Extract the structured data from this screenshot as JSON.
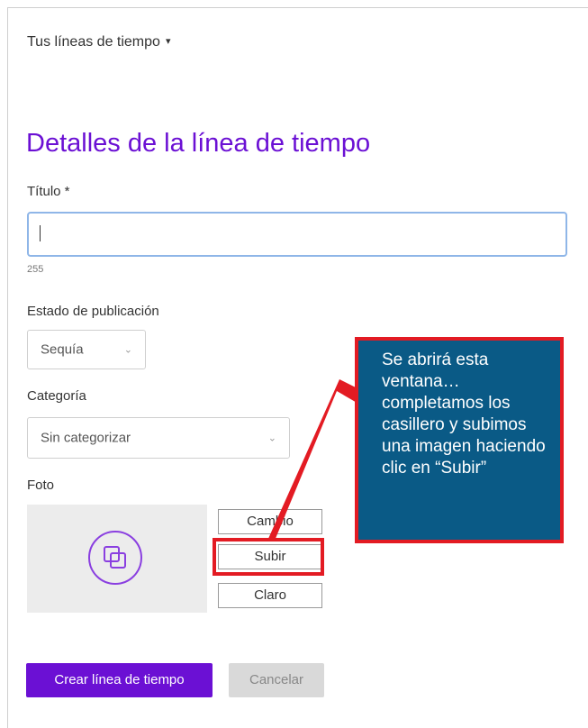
{
  "header": {
    "timelines_menu_label": "Tus líneas de tiempo",
    "caret": "▾"
  },
  "page": {
    "title": "Detalles de la línea de tiempo"
  },
  "form": {
    "title_label": "Título *",
    "title_value": "",
    "char_counter": "255",
    "status_label": "Estado de publicación",
    "status_value": "Sequía",
    "category_label": "Categoría",
    "category_value": "Sin categorizar",
    "photo_label": "Foto"
  },
  "photo_buttons": {
    "change": "Cambio",
    "upload": "Subir",
    "clear": "Claro"
  },
  "actions": {
    "create": "Crear línea de tiempo",
    "cancel": "Cancelar"
  },
  "callout": {
    "text": "Se abrirá esta ventana… completamos los casillero y subimos una imagen haciendo clic en “Subir”"
  },
  "icons": {
    "photo": "stacked-squares-icon",
    "dropdown": "chevron-down-icon"
  },
  "colors": {
    "accent": "#6b10d4",
    "callout_bg": "#0a5a86",
    "highlight": "#e31b23"
  }
}
